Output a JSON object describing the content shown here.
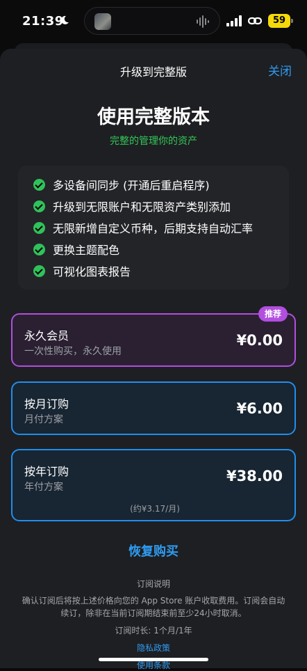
{
  "status": {
    "time": "21:39",
    "battery": "59"
  },
  "nav": {
    "title": "升级到完整版",
    "close": "关闭"
  },
  "hero": {
    "title": "使用完整版本",
    "subtitle": "完整的管理你的资产"
  },
  "features": [
    "多设备间同步 (开通后重启程序)",
    "升级到无限账户和无限资产类别添加",
    "无限新增自定义币种，后期支持自动汇率",
    "更换主题配色",
    "可视化图表报告"
  ],
  "plans": {
    "lifetime": {
      "name": "永久会员",
      "desc": "一次性购买，永久使用",
      "price": "¥0.00",
      "badge": "推荐"
    },
    "monthly": {
      "name": "按月订购",
      "desc": "月付方案",
      "price": "¥6.00"
    },
    "yearly": {
      "name": "按年订购",
      "desc": "年付方案",
      "price": "¥38.00",
      "note": "(约¥3.17/月)"
    }
  },
  "restore": "恢复购买",
  "terms": {
    "heading": "订阅说明",
    "body": "确认订阅后将按上述价格向您的 App Store 账户收取费用。订阅会自动续订，除非在当前订阅期结束前至少24小时取消。",
    "duration": "订阅时长: 1个月/1年",
    "privacy": "隐私政策",
    "use": "使用条款"
  },
  "colors": {
    "accent": "#2f9bf1",
    "green": "#33c759",
    "purple": "#b24ee0",
    "blue_border": "#1f8ef0"
  }
}
